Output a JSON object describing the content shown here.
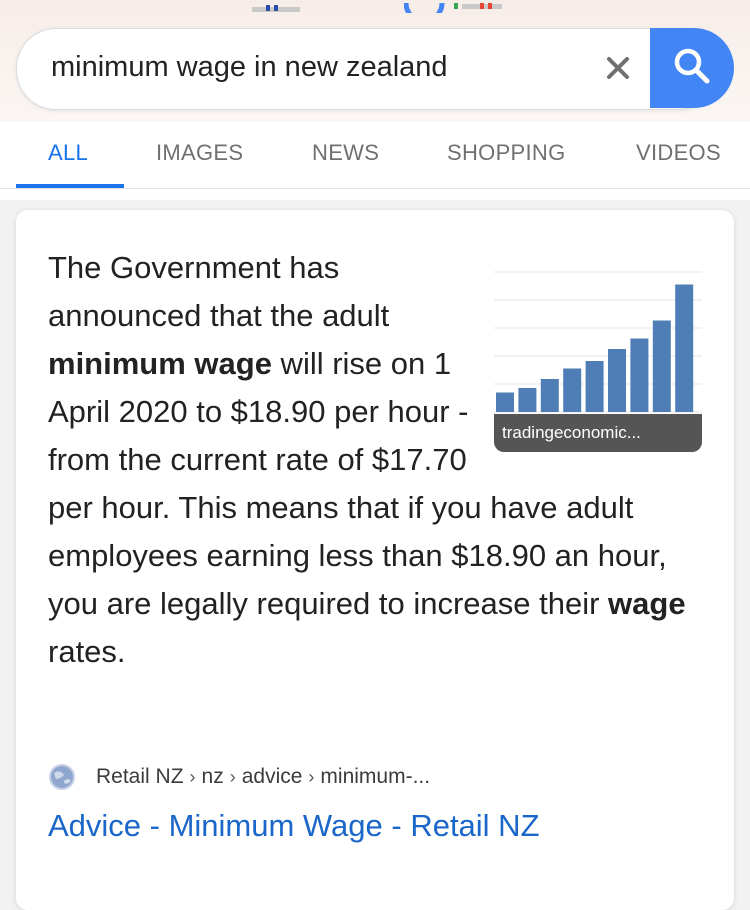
{
  "search": {
    "query": "minimum wage in new zealand",
    "clear_icon": "close-icon",
    "search_icon": "search-icon"
  },
  "tabs": [
    {
      "label": "ALL",
      "active": true
    },
    {
      "label": "IMAGES",
      "active": false
    },
    {
      "label": "NEWS",
      "active": false
    },
    {
      "label": "SHOPPING",
      "active": false
    },
    {
      "label": "VIDEOS",
      "active": false
    }
  ],
  "featured_snippet": {
    "text_1": "The Government has announced that the adult ",
    "bold_1": "minimum wage",
    "text_2": " will rise on 1 April 2020 to $18.90 per hour - from the current rate of $17.70 per hour. This means that if you have adult employees earning less than $18.90 an hour, you are legally required to increase their ",
    "bold_2": "wage",
    "text_3": " rates.",
    "thumbnail": {
      "caption": "tradingeconomic...",
      "bar_color": "#4f7db5",
      "bar_levels": [
        0.13,
        0.16,
        0.22,
        0.29,
        0.34,
        0.42,
        0.49,
        0.61,
        0.85
      ]
    },
    "source": {
      "site": "Retail NZ",
      "path": [
        "nz",
        "advice",
        "minimum-..."
      ],
      "icon": "globe-icon"
    },
    "link_title": "Advice - Minimum Wage - Retail NZ"
  },
  "colors": {
    "accent": "#4285f4",
    "tab_active": "#1a73e8",
    "link": "#1a66c9"
  }
}
